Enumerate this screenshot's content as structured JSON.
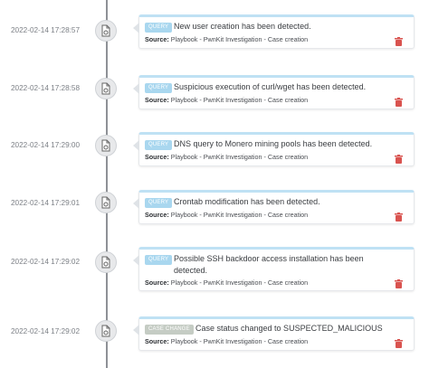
{
  "entries": [
    {
      "timestamp": "2022-02-14 17:28:57",
      "badge": "QUERY",
      "badge_kind": "query",
      "message": "New user creation has been detected.",
      "source_label": "Source:",
      "source_value": "Playbook - PwnKit Investigation - Case creation"
    },
    {
      "timestamp": "2022-02-14 17:28:58",
      "badge": "QUERY",
      "badge_kind": "query",
      "message": "Suspicious execution of curl/wget has been detected.",
      "source_label": "Source:",
      "source_value": "Playbook - PwnKit Investigation - Case creation"
    },
    {
      "timestamp": "2022-02-14 17:29:00",
      "badge": "QUERY",
      "badge_kind": "query",
      "message": "DNS query to Monero mining pools has been detected.",
      "source_label": "Source:",
      "source_value": "Playbook - PwnKit Investigation - Case creation"
    },
    {
      "timestamp": "2022-02-14 17:29:01",
      "badge": "QUERY",
      "badge_kind": "query",
      "message": "Crontab modification has been detected.",
      "source_label": "Source:",
      "source_value": "Playbook - PwnKit Investigation - Case creation"
    },
    {
      "timestamp": "2022-02-14 17:29:02",
      "badge": "QUERY",
      "badge_kind": "query",
      "message": "Possible SSH backdoor access installation has been detected.",
      "source_label": "Source:",
      "source_value": "Playbook - PwnKit Investigation - Case creation"
    },
    {
      "timestamp": "2022-02-14 17:29:02",
      "badge": "CASE CHANGE",
      "badge_kind": "case",
      "message": "Case status changed to SUSPECTED_MALICIOUS",
      "source_label": "Source:",
      "source_value": "Playbook - PwnKit Investigation - Case creation"
    }
  ],
  "icons": {
    "node": "document-gear-icon",
    "delete": "trash-icon"
  },
  "colors": {
    "query_badge": "#a9d7ef",
    "case_badge": "#c5ccc4",
    "card_top_border": "#bfe1f4",
    "trash": "#d9534f",
    "timeline": "#8e9196"
  }
}
